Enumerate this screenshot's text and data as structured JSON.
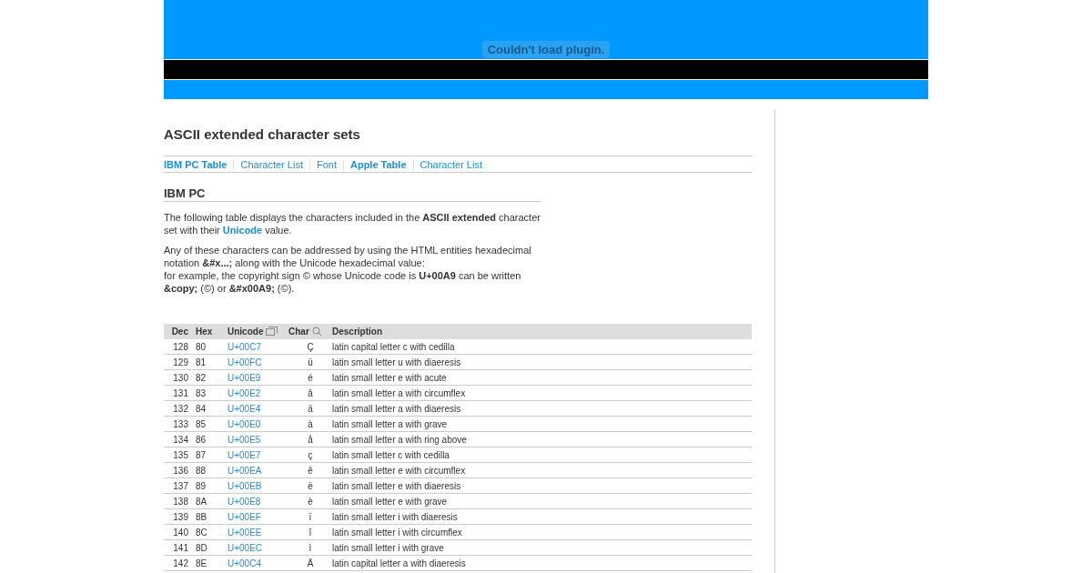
{
  "plugin_notice": "Couldn't load plugin.",
  "title": "ASCII extended character sets",
  "nav": [
    {
      "label": "IBM PC Table",
      "bold": true
    },
    {
      "label": "Character List",
      "bold": false
    },
    {
      "label": "Font",
      "bold": false
    },
    {
      "label": "Apple Table",
      "bold": true
    },
    {
      "label": "Character List",
      "bold": false
    }
  ],
  "section_heading": "IBM PC",
  "intro": {
    "before": "The following table displays the characters included in the **ASCII extended** character set with their",
    "link": "Unicode",
    "after": "value."
  },
  "notes": [
    "Any of these characters can be addressed by using the HTML entities hexadecimal notation **&#x...;** along with the Unicode hexadecimal value:",
    "for example, the copyright sign © whose Unicode code is **U+00A9** can be written",
    "**&copy;** (©) or **&#x00A9;** (©)."
  ],
  "table": {
    "columns": [
      {
        "label": "Dec",
        "kind": "plain"
      },
      {
        "label": "Hex",
        "kind": "plain"
      },
      {
        "label": "Unicode",
        "kind": "window"
      },
      {
        "label": "Char",
        "kind": "search"
      },
      {
        "label": "Description",
        "kind": "plain"
      }
    ],
    "rows": [
      [
        "128",
        "80",
        "U+00C7",
        "Ç",
        "latin capital letter c with cedilla"
      ],
      [
        "129",
        "81",
        "U+00FC",
        "ü",
        "latin small letter u with diaeresis"
      ],
      [
        "130",
        "82",
        "U+00E9",
        "é",
        "latin small letter e with acute"
      ],
      [
        "131",
        "83",
        "U+00E2",
        "â",
        "latin small letter a with circumflex"
      ],
      [
        "132",
        "84",
        "U+00E4",
        "ä",
        "latin small letter a with diaeresis"
      ],
      [
        "133",
        "85",
        "U+00E0",
        "à",
        "latin small letter a with grave"
      ],
      [
        "134",
        "86",
        "U+00E5",
        "å",
        "latin small letter a with ring above"
      ],
      [
        "135",
        "87",
        "U+00E7",
        "ç",
        "latin small letter c with cedilla"
      ],
      [
        "136",
        "88",
        "U+00EA",
        "ê",
        "latin small letter e with circumflex"
      ],
      [
        "137",
        "89",
        "U+00EB",
        "ë",
        "latin small letter e with diaeresis"
      ],
      [
        "138",
        "8A",
        "U+00E8",
        "è",
        "latin small letter e with grave"
      ],
      [
        "139",
        "8B",
        "U+00EF",
        "ï",
        "latin small letter i with diaeresis"
      ],
      [
        "140",
        "8C",
        "U+00EE",
        "î",
        "latin small letter i with circumflex"
      ],
      [
        "141",
        "8D",
        "U+00EC",
        "ì",
        "latin small letter i with grave"
      ],
      [
        "142",
        "8E",
        "U+00C4",
        "Ä",
        "latin capital letter a with diaeresis"
      ]
    ]
  }
}
